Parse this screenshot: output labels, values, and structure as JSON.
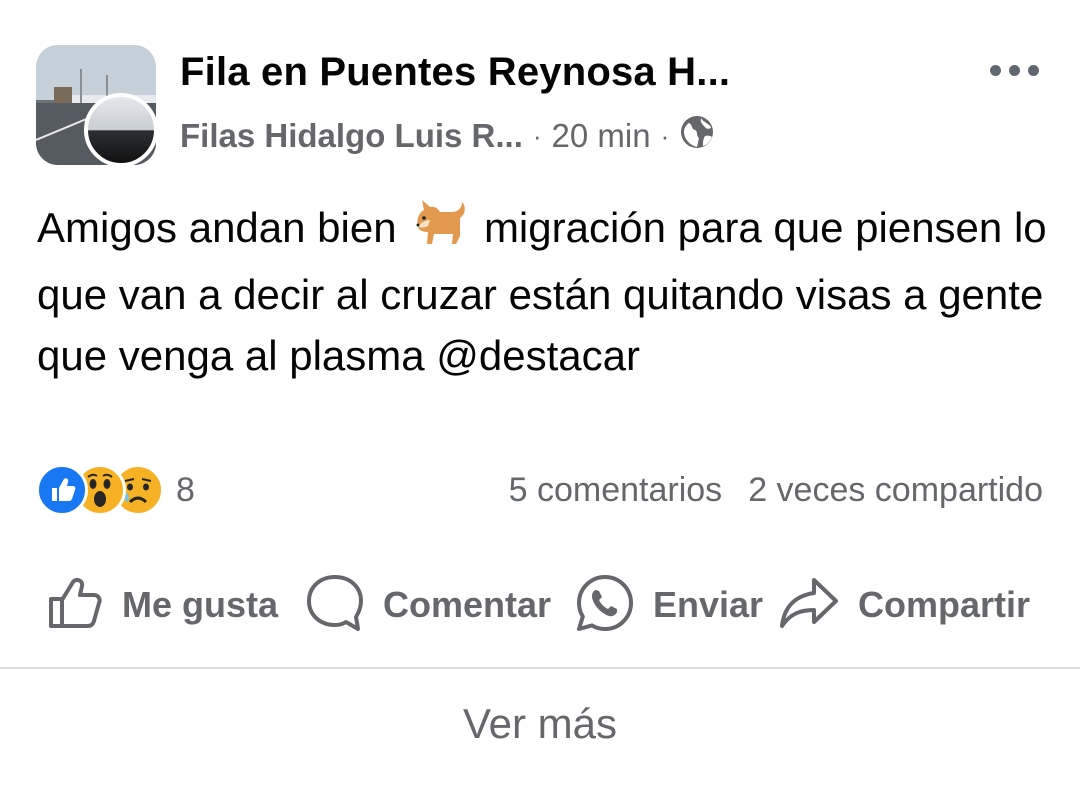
{
  "post": {
    "group_name": "Fila en Puentes Reynosa H...",
    "author": "Filas Hidalgo Luis R...",
    "separator": "·",
    "time": "20 min",
    "privacy_icon": "globe-icon",
    "text_before_emoji": "Amigos andan bien",
    "emoji": "dog-emoji",
    "text_after_emoji": "migración para que piensen lo que van a decir al cruzar están quitando visas a gente que venga al plasma @destacar"
  },
  "reactions": {
    "types": [
      "like",
      "wow",
      "sad"
    ],
    "count": "8"
  },
  "stats": {
    "comments": "5 comentarios",
    "shares": "2 veces compartido"
  },
  "actions": {
    "like": "Me gusta",
    "comment": "Comentar",
    "send": "Enviar",
    "share": "Compartir"
  },
  "footer": {
    "see_more": "Ver más"
  },
  "colors": {
    "text": "#050505",
    "secondary": "#65676b",
    "like_blue": "#1877f2",
    "reaction_yellow": "#f7b125",
    "divider": "#dadde1"
  }
}
